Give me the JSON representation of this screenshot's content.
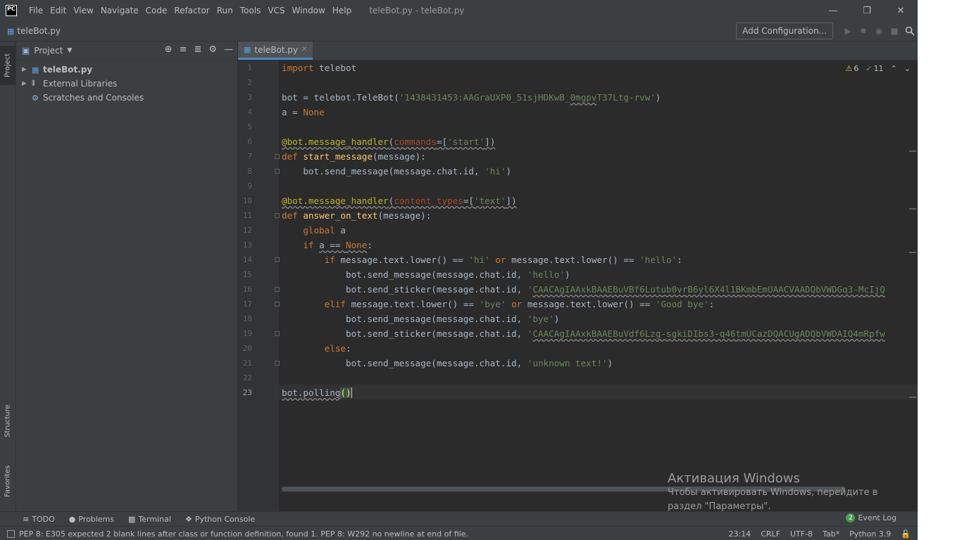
{
  "menu": {
    "logo": "PC",
    "items": [
      "File",
      "Edit",
      "View",
      "Navigate",
      "Code",
      "Refactor",
      "Run",
      "Tools",
      "VCS",
      "Window",
      "Help"
    ],
    "window_title": "teleBot.py - teleBot.py"
  },
  "navbar": {
    "file": "teleBot.py",
    "add_config": "Add Configuration..."
  },
  "left_tabs": {
    "project": "Project",
    "structure": "Structure",
    "favorites": "Favorites"
  },
  "project_panel": {
    "title": "Project",
    "tree": [
      {
        "label": "teleBot.py",
        "bold": true
      },
      {
        "label": "External Libraries",
        "bold": false
      },
      {
        "label": "Scratches and Consoles",
        "bold": false
      }
    ]
  },
  "editor": {
    "tab": "teleBot.py",
    "warnings": "6",
    "weak_warnings": "11",
    "current_line": 23,
    "line_numbers": [
      "1",
      "2",
      "3",
      "4",
      "5",
      "6",
      "7",
      "8",
      "9",
      "10",
      "11",
      "12",
      "13",
      "14",
      "15",
      "16",
      "17",
      "18",
      "19",
      "20",
      "21",
      "22",
      "23"
    ]
  },
  "bottom_tabs": {
    "todo": "TODO",
    "problems": "Problems",
    "terminal": "Terminal",
    "python_console": "Python Console",
    "event_log": "Event Log",
    "event_count": "2"
  },
  "status": {
    "message": "PEP 8: E305 expected 2 blank lines after class or function definition, found 1. PEP 8: W292 no newline at end of file.",
    "position": "23:14",
    "line_sep": "CRLF",
    "encoding": "UTF-8",
    "indent": "Tab*",
    "interpreter": "Python 3.9"
  },
  "watermark": {
    "title": "Активация Windows",
    "line1": "Чтобы активировать Windows, перейдите в",
    "line2": "раздел \"Параметры\"."
  }
}
